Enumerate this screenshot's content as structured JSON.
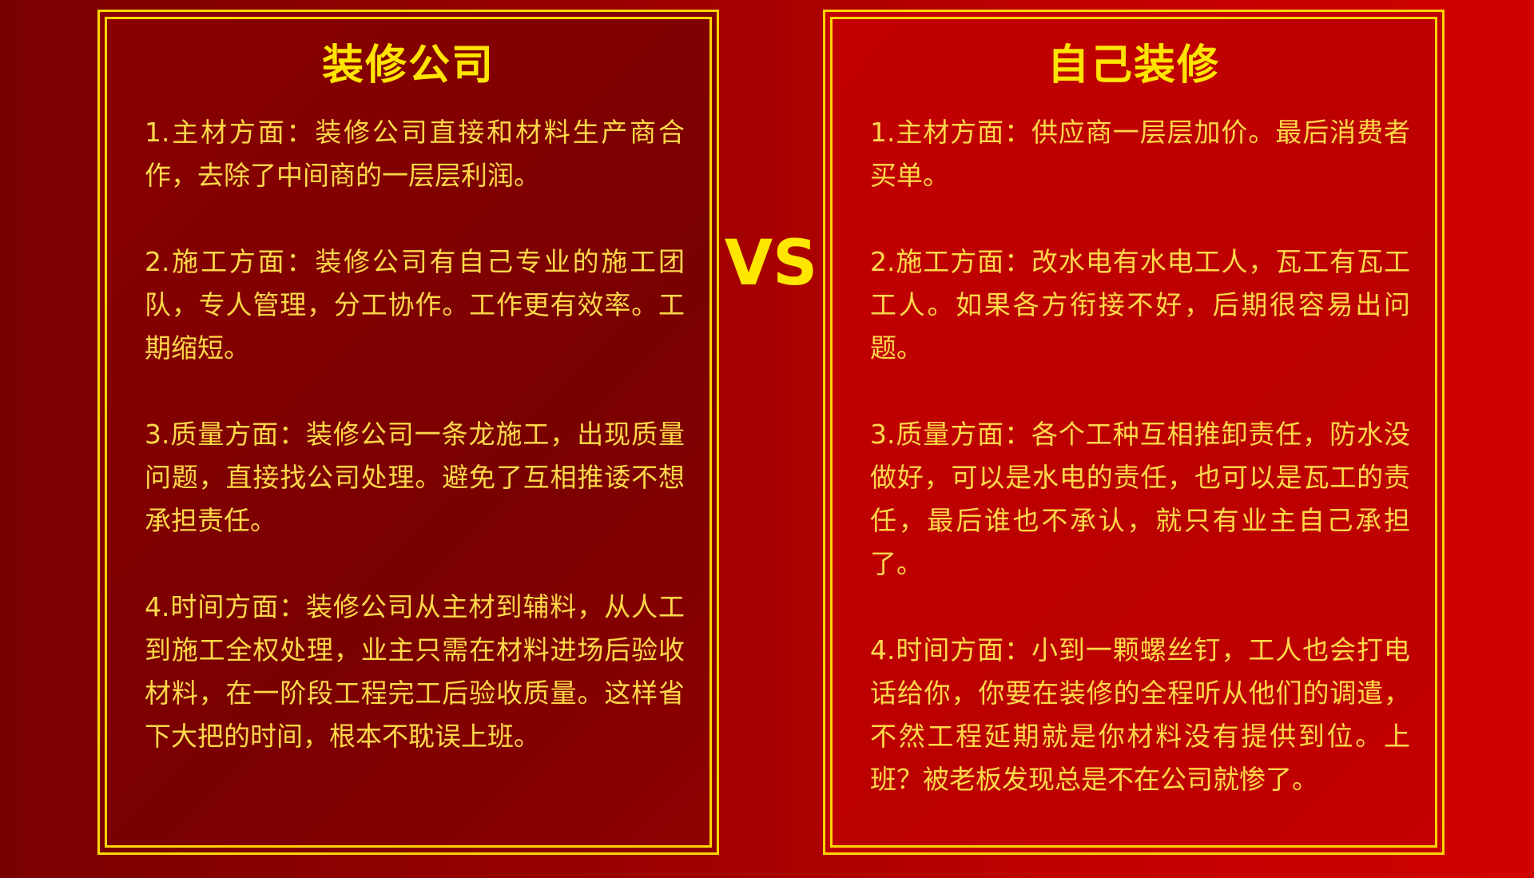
{
  "left": {
    "title": "装修公司",
    "items": [
      "1.主材方面：装修公司直接和材料生产商合作，去除了中间商的一层层利润。",
      "2.施工方面：装修公司有自己专业的施工团队，专人管理，分工协作。工作更有效率。工期缩短。",
      "3.质量方面：装修公司一条龙施工，出现质量问题，直接找公司处理。避免了互相推诿不想承担责任。",
      "4.时间方面：装修公司从主材到辅料，从人工到施工全权处理，业主只需在材料进场后验收材料，在一阶段工程完工后验收质量。这样省下大把的时间，根本不耽误上班。"
    ]
  },
  "vs_label": "VS",
  "right": {
    "title": "自己装修",
    "items": [
      "1.主材方面：供应商一层层加价。最后消费者买单。",
      "2.施工方面：改水电有水电工人，瓦工有瓦工工人。如果各方衔接不好，后期很容易出问题。",
      "3.质量方面：各个工种互相推卸责任，防水没做好，可以是水电的责任，也可以是瓦工的责任，最后谁也不承认，就只有业主自己承担了。",
      "4.时间方面：小到一颗螺丝钉，工人也会打电话给你，你要在装修的全程听从他们的调遣，不然工程延期就是你材料没有提供到位。上班？被老板发现总是不在公司就惨了。"
    ]
  },
  "colors": {
    "accent_yellow": "#ffd500",
    "title_yellow": "#ffe400",
    "text_yellow": "#ffd84a",
    "left_panel_bg": "#800000",
    "right_panel_bg": "#c00000"
  }
}
